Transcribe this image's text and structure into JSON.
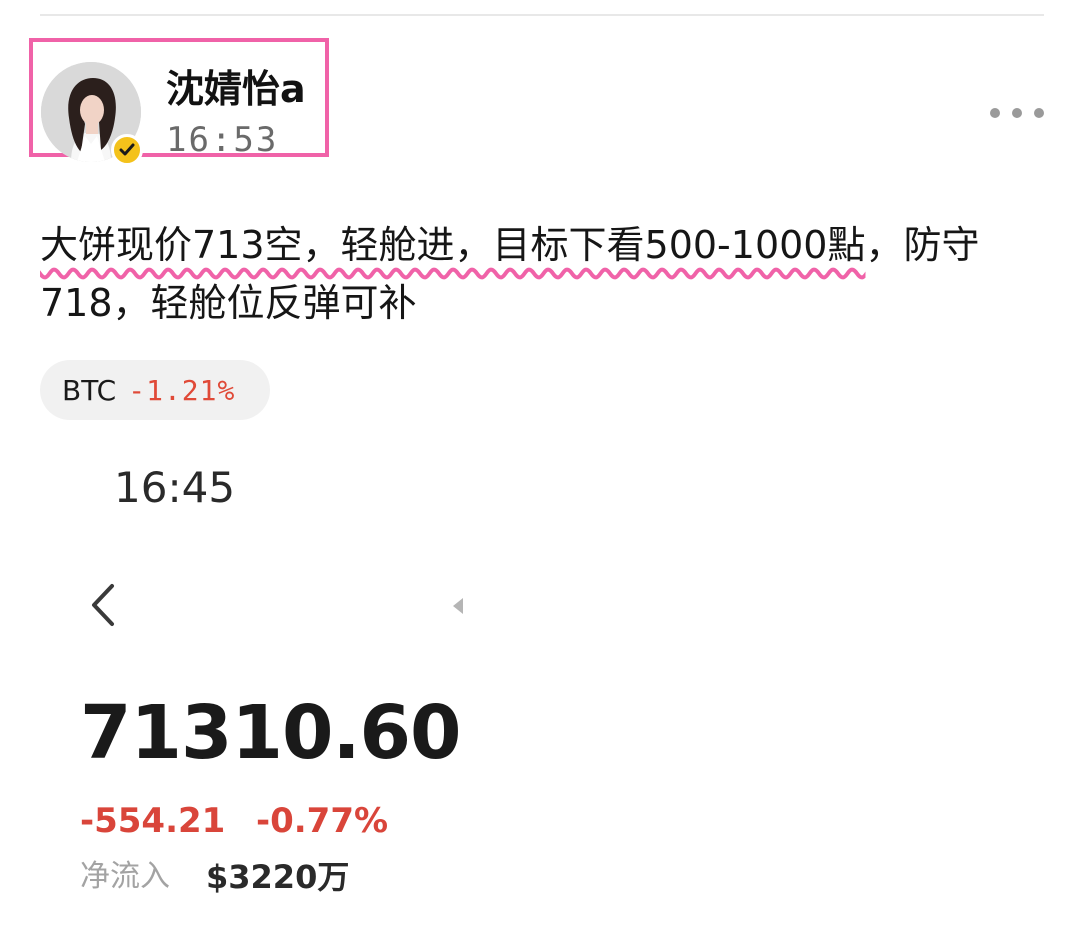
{
  "post": {
    "author": {
      "name": "沈婧怡a",
      "time": "16:53",
      "verified": true,
      "avatar_icon": "portrait-avatar"
    },
    "more_icon": "more-horizontal-icon",
    "text_underlined": "大饼现价713空，轻舱进，目标下看500-1000點",
    "text_rest": "，防守718，轻舱位反弹可补",
    "ticker": {
      "symbol": "BTC",
      "change": "-1.21%"
    }
  },
  "screenshot": {
    "time": "16:45",
    "back_icon": "chevron-left-icon",
    "price": "71310.60",
    "change": "-554.21",
    "change_percent": "-0.77%",
    "netflow_label": "净流入",
    "netflow_value": "$3220万"
  },
  "colors": {
    "highlight_border": "#f062a8",
    "negative": "#d9453a",
    "badge": "#f4c21b"
  }
}
